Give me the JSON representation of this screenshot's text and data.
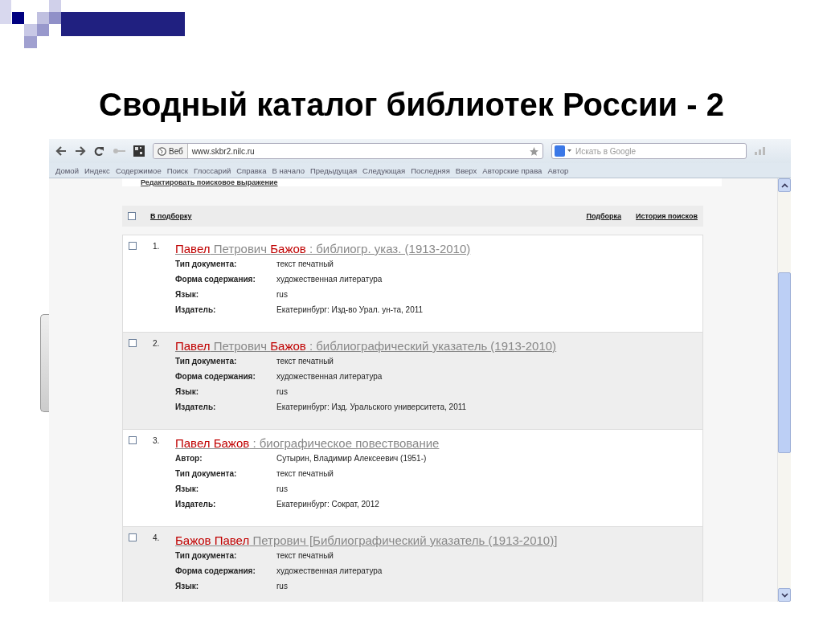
{
  "slide": {
    "title": "Сводный каталог библиотек России - 2"
  },
  "browser": {
    "tab_label": "Веб",
    "url": "www.skbr2.nilc.ru",
    "search": {
      "placeholder": "Искать в Google"
    },
    "bookmarks": [
      "Домой",
      "Индекс",
      "Содержимое",
      "Поиск",
      "Глоссарий",
      "Справка",
      "В начало",
      "Предыдущая",
      "Следующая",
      "Последняя",
      "Вверх",
      "Авторские права",
      "Автор"
    ]
  },
  "page": {
    "edit_link": "Редактировать поисковое выражение",
    "header": {
      "checked": false,
      "add_link": "В подборку",
      "links": [
        "Подборка",
        "История поисков"
      ]
    },
    "results": [
      {
        "number": "1.",
        "checked": false,
        "title": [
          {
            "text": "Павел",
            "highlight": true
          },
          {
            "text": " Петрович ",
            "highlight": false
          },
          {
            "text": "Бажов",
            "highlight": true
          },
          {
            "text": " : библиогр. указ. (1913-2010)",
            "highlight": false
          }
        ],
        "fields": [
          {
            "label": "Тип документа:",
            "value": "текст печатный"
          },
          {
            "label": "Форма содержания:",
            "value": "художественная литература"
          },
          {
            "label": "Язык:",
            "value": "rus"
          },
          {
            "label": "Издатель:",
            "value": "Екатеринбург: Изд-во Урал. ун-та, 2011"
          }
        ]
      },
      {
        "number": "2.",
        "checked": false,
        "title": [
          {
            "text": "Павел",
            "highlight": true
          },
          {
            "text": " Петрович ",
            "highlight": false
          },
          {
            "text": "Бажов",
            "highlight": true
          },
          {
            "text": " : библиографический указатель (1913-2010)",
            "highlight": false
          }
        ],
        "fields": [
          {
            "label": "Тип документа:",
            "value": "текст печатный"
          },
          {
            "label": "Форма содержания:",
            "value": "художественная литература"
          },
          {
            "label": "Язык:",
            "value": "rus"
          },
          {
            "label": "Издатель:",
            "value": "Екатеринбург: Изд. Уральского университета, 2011"
          }
        ]
      },
      {
        "number": "3.",
        "checked": false,
        "title": [
          {
            "text": "Павел Бажов",
            "highlight": true
          },
          {
            "text": " : биографическое повествование",
            "highlight": false
          }
        ],
        "fields": [
          {
            "label": "Автор:",
            "value": "Сутырин, Владимир Алексеевич (1951-)"
          },
          {
            "label": "Тип документа:",
            "value": "текст печатный"
          },
          {
            "label": "Язык:",
            "value": "rus"
          },
          {
            "label": "Издатель:",
            "value": "Екатеринбург: Сократ, 2012"
          }
        ]
      },
      {
        "number": "4.",
        "checked": false,
        "title": [
          {
            "text": "Бажов Павел",
            "highlight": true
          },
          {
            "text": " Петрович [Библиографический указатель (1913-2010)]",
            "highlight": false
          }
        ],
        "fields": [
          {
            "label": "Тип документа:",
            "value": "текст печатный"
          },
          {
            "label": "Форма содержания:",
            "value": "художественная литература"
          },
          {
            "label": "Язык:",
            "value": "rus"
          }
        ]
      }
    ]
  }
}
